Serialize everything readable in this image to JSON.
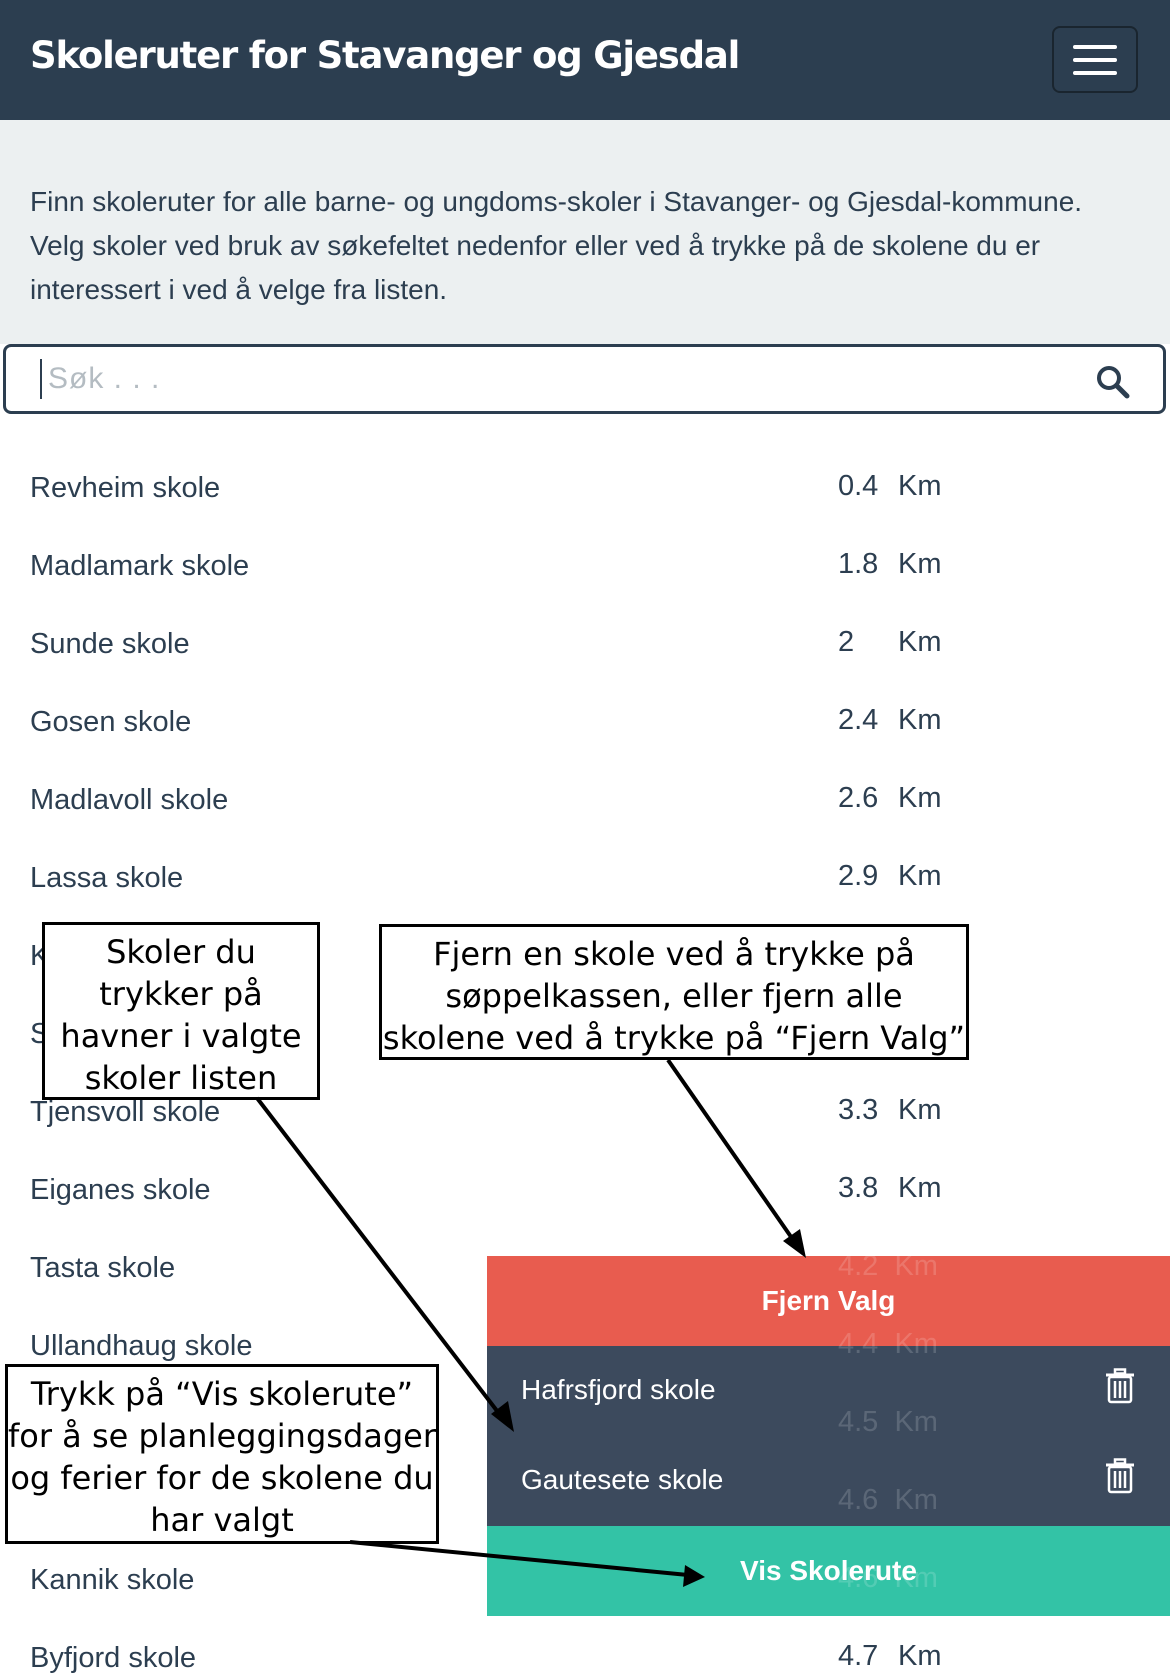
{
  "navbar": {
    "title": "Skoleruter for Stavanger og Gjesdal",
    "menu_icon": "hamburger-menu-icon"
  },
  "intro": {
    "text": "Finn skoleruter for alle barne- og ungdoms-skoler i Stavanger- og Gjesdal-kommune. Velg skoler ved bruk av søkefeltet nedenfor eller ved å trykke på de skolene du er interessert i ved å velge fra listen."
  },
  "search": {
    "placeholder": "Søk . . .",
    "value": "",
    "icon": "search-icon"
  },
  "schools": [
    {
      "name": "Revheim skole",
      "distance": "0.4",
      "unit": "Km"
    },
    {
      "name": "Madlamark skole",
      "distance": "1.8",
      "unit": "Km"
    },
    {
      "name": "Sunde skole",
      "distance": "2",
      "unit": "Km"
    },
    {
      "name": "Gosen skole",
      "distance": "2.4",
      "unit": "Km"
    },
    {
      "name": "Madlavoll skole",
      "distance": "2.6",
      "unit": "Km"
    },
    {
      "name": "Lassa skole",
      "distance": "2.9",
      "unit": "Km"
    },
    {
      "name": "K",
      "distance": "",
      "unit": ""
    },
    {
      "name": "S",
      "distance": "",
      "unit": ""
    },
    {
      "name": "Tjensvoll skole",
      "distance": "3.3",
      "unit": "Km"
    },
    {
      "name": "Eiganes skole",
      "distance": "3.8",
      "unit": "Km"
    },
    {
      "name": "Tasta skole",
      "distance": "",
      "unit": ""
    },
    {
      "name": "Ullandhaug skole",
      "distance": "",
      "unit": ""
    },
    {
      "name": "",
      "distance": "",
      "unit": ""
    },
    {
      "name": "",
      "distance": "",
      "unit": ""
    },
    {
      "name": "Kannik skole",
      "distance": "",
      "unit": ""
    },
    {
      "name": "Byfjord skole",
      "distance": "4.7",
      "unit": "Km"
    }
  ],
  "ghost_distances": [
    {
      "distance": "4.2",
      "unit": "Km"
    },
    {
      "distance": "4.4",
      "unit": "Km"
    },
    {
      "distance": "4.5",
      "unit": "Km"
    },
    {
      "distance": "4.6",
      "unit": "Km"
    },
    {
      "distance": "4.6",
      "unit": "Km"
    }
  ],
  "selected": {
    "clear_label": "Fjern Valg",
    "items": [
      {
        "name": "Hafrsfjord skole",
        "icon": "trash-icon"
      },
      {
        "name": "Gautesete skole",
        "icon": "trash-icon"
      }
    ],
    "show_label": "Vis Skolerute"
  },
  "colors": {
    "navbar": "#2c3e50",
    "intro_bg": "#ecf0f1",
    "clear_button": "#e85c4f",
    "selected_item": "#3c4a5d",
    "show_button": "#33c3a6"
  },
  "callouts": {
    "list_hint": "Skoler du trykker på havner i valgte skoler listen",
    "remove_hint": "Fjern en skole ved å trykke på søppelkassen, eller fjern alle skolene ved å trykke på “Fjern Valg”",
    "show_hint": "Trykk på “Vis skolerute” for å se planleggingsdager og ferier for de skolene du har valgt"
  }
}
